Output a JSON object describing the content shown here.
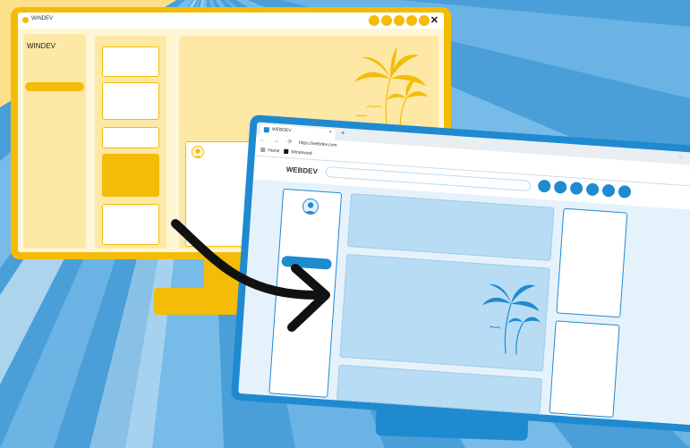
{
  "colors": {
    "windev_accent": "#f4bc06",
    "windev_panel": "#fde8a6",
    "webdev_accent": "#1f8ad0",
    "webdev_panel": "#b8dcf4"
  },
  "windev_window": {
    "title": "WINDEV",
    "window_controls": [
      "circle-button",
      "circle-button",
      "circle-button",
      "circle-button",
      "circle-button"
    ],
    "close_glyph": "✕",
    "brand": "WINDEV",
    "icons": [
      "palm-tree-icon",
      "user-avatar-icon"
    ]
  },
  "webdev_browser": {
    "tab_title": "WEBDEV",
    "tab_close_glyph": "×",
    "new_tab_glyph": "+",
    "window_controls_glyphs": "–  □  ✕",
    "nav_glyphs": "←  →  ⟳",
    "url": "https://webdev.com",
    "toolbar_glyphs": "☆  ⋮",
    "bookmarks": [
      {
        "label": "Home",
        "icon": "folder-icon"
      },
      {
        "label": "Windowed",
        "icon": "window-icon"
      }
    ],
    "page_brand": "WEBDEV",
    "header_buttons": [
      "circle-button",
      "circle-button",
      "circle-button",
      "circle-button",
      "circle-button",
      "circle-button"
    ],
    "icons": [
      "palm-tree-icon",
      "user-avatar-icon"
    ]
  },
  "conversion_arrow": {
    "from": "WINDEV",
    "to": "WEBDEV",
    "icon": "curved-arrow-icon"
  }
}
